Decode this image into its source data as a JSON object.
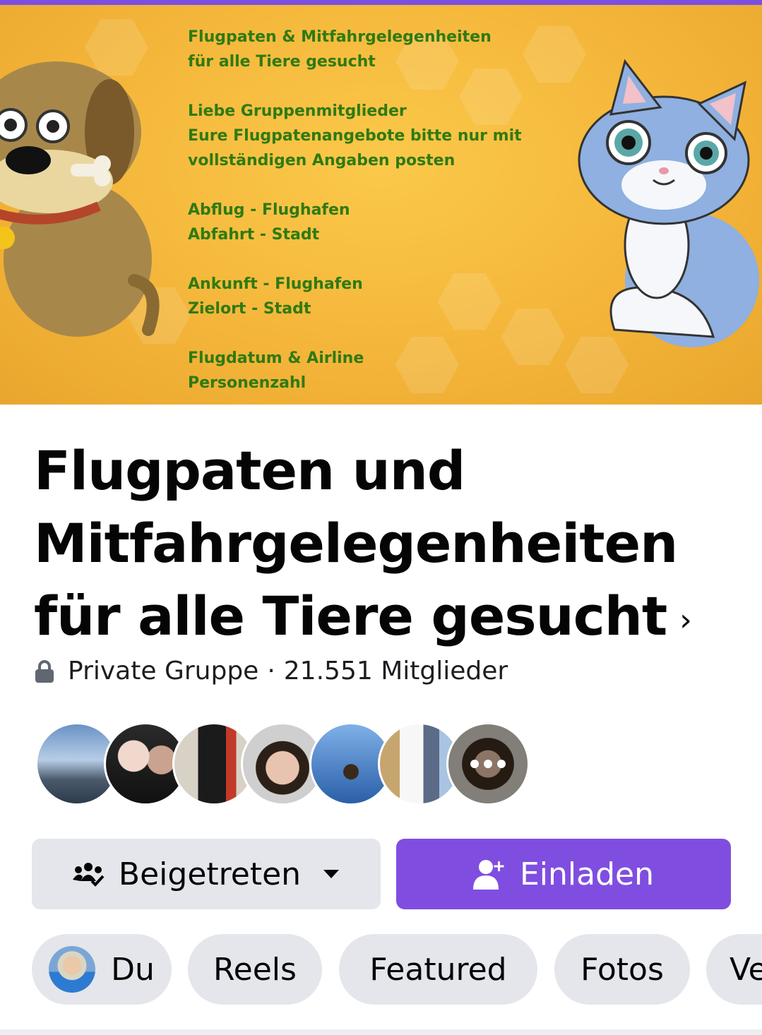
{
  "cover": {
    "lines": [
      "Flugpaten & Mitfahrgelegenheiten",
      "für alle Tiere gesucht",
      "",
      "Liebe Gruppenmitglieder",
      "Eure Flugpatenangebote bitte nur mit",
      "vollständigen Angaben posten",
      "",
      "Abflug - Flughafen",
      "Abfahrt - Stadt",
      "",
      "Ankunft - Flughafen",
      "Zielort - Stadt",
      "",
      "Flugdatum & Airline",
      "Personenzahl"
    ]
  },
  "group": {
    "title": "Flugpaten und Mitfahrgelegenheiten für alle Tiere gesucht",
    "chevron": "›",
    "privacy": "Private Gruppe",
    "separator": "·",
    "members": "21.551 Mitglieder"
  },
  "actions": {
    "joined_label": "Beigetreten",
    "invite_label": "Einladen"
  },
  "tabs": [
    {
      "label": "Du"
    },
    {
      "label": "Reels"
    },
    {
      "label": "Featured"
    },
    {
      "label": "Fotos"
    },
    {
      "label": "Ve"
    }
  ],
  "colors": {
    "accent": "#7f4ee0",
    "button_gray": "#e4e6eb",
    "cover_text": "#2f7a12"
  },
  "icons": {
    "privacy": "lock-icon",
    "joined": "group-check-icon",
    "dropdown": "caret-down-icon",
    "invite": "add-person-icon"
  }
}
